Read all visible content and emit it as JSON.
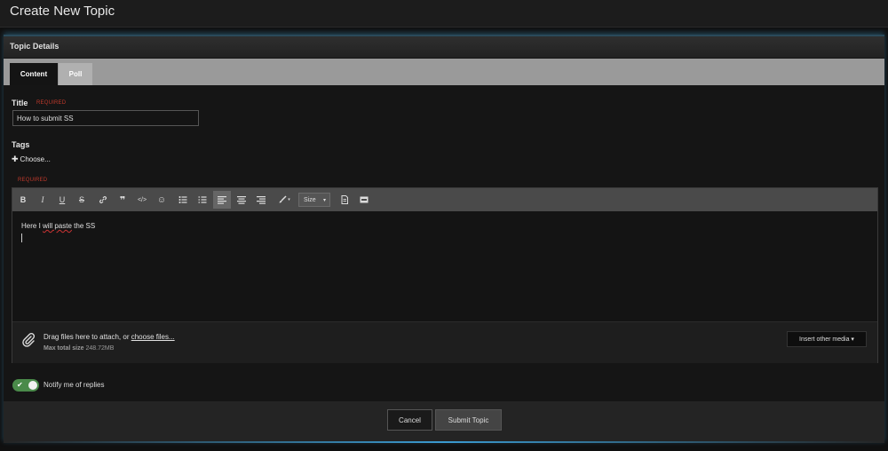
{
  "header": {
    "title": "Create New Topic"
  },
  "panel": {
    "title": "Topic Details"
  },
  "tabs": [
    {
      "label": "Content"
    },
    {
      "label": "Poll"
    }
  ],
  "form": {
    "title_label": "Title",
    "required_text": "REQUIRED",
    "title_value": "How to submit SS",
    "tags_label": "Tags",
    "choose_label": "Choose...",
    "editor_required_text": "REQUIRED"
  },
  "toolbar": {
    "bold": "B",
    "italic": "I",
    "underline": "U",
    "strike": "S",
    "size_label": "Size"
  },
  "editor": {
    "content_prefix": "Here I ",
    "content_misspelled": "will paste",
    "content_suffix": " the SS"
  },
  "attachments": {
    "drag_text": "Drag files here to attach, or ",
    "choose_files": "choose files...",
    "max_label": "Max total size",
    "max_value": "248.72MB",
    "insert_media": "Insert other media ▾"
  },
  "notify": {
    "label": "Notify me of replies",
    "checked": true
  },
  "footer": {
    "cancel": "Cancel",
    "submit": "Submit Topic"
  },
  "colors": {
    "accent_glow": "#3a9ad0",
    "toggle_on": "#4a8a4a",
    "required": "#c0392b"
  }
}
